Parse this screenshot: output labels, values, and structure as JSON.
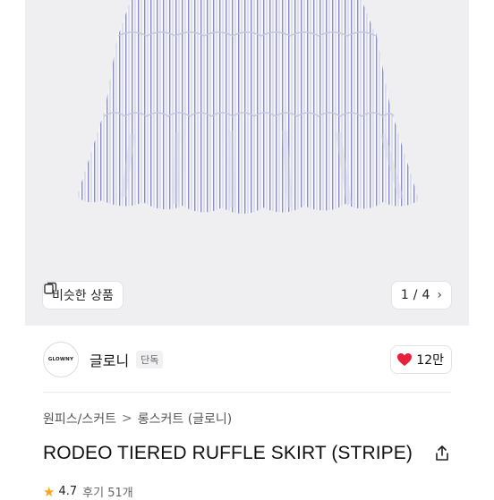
{
  "gallery": {
    "similar_label": "비슷한 상품",
    "pager_current": "1",
    "pager_sep": "/",
    "pager_total": "4",
    "icons": {
      "similar": "similar-products-icon",
      "next": "chevron-right-icon"
    }
  },
  "brand": {
    "logo_text": "GLOWNY",
    "name": "글로니",
    "badge": "단독"
  },
  "like": {
    "count": "12만",
    "color": "#e8213b"
  },
  "breadcrumb": {
    "parent": "원피스/스커트",
    "separator": ">",
    "current": "롱스커트 (글로니)"
  },
  "product": {
    "title": "RODEO TIERED RUFFLE SKIRT (STRIPE)"
  },
  "rating": {
    "score": "4.7",
    "review_label": "후기 51개"
  },
  "colors": {
    "hero_bg": "#efeff1",
    "stripe": "#8a8fc4",
    "heart": "#e8213b"
  }
}
